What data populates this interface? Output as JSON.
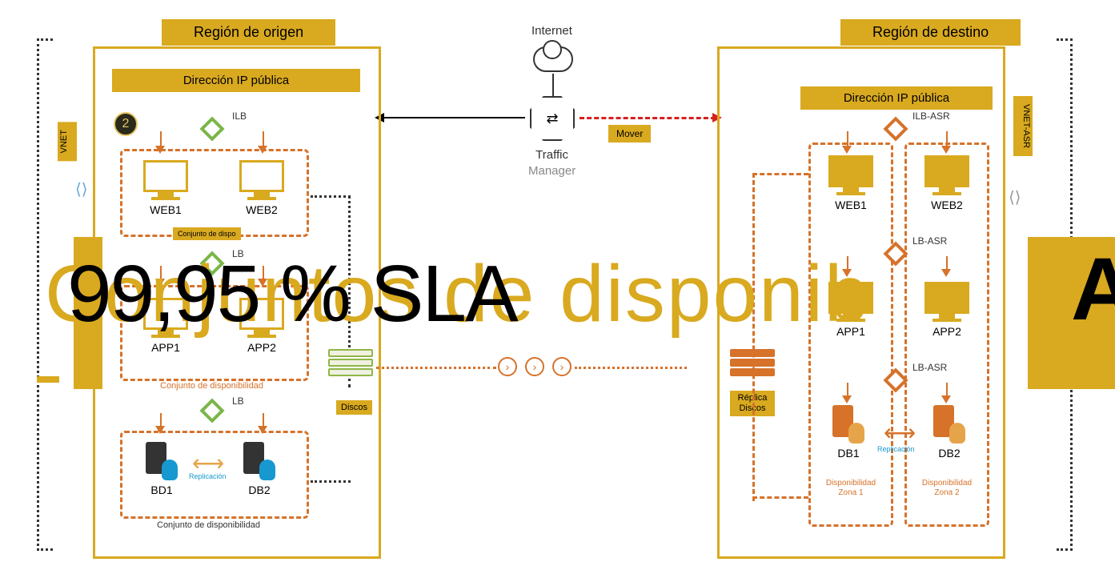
{
  "diagram": {
    "internet_label": "Internet",
    "traffic_manager": "Traffic",
    "traffic_manager_sub": "Manager",
    "mover_label": "Mover"
  },
  "source": {
    "region_title": "Región de origen",
    "public_ip": "Dirección IP pública",
    "ilb": "ILB",
    "lb1": "LB",
    "lb2": "LB",
    "web1": "WEB1",
    "web2": "WEB2",
    "app1": "APP1",
    "app2": "APP2",
    "db1": "BD1",
    "db2": "DB2",
    "avail1": "Conjunto de dispo",
    "avail2": "Conjunto de disponibilidad",
    "avail3": "Conjunto de disponibilidad",
    "replication": "Replicación",
    "discos": "Discos",
    "vnet": "VNET",
    "badge": "2"
  },
  "target": {
    "region_title": "Región de destino",
    "public_ip": "Dirección IP pública",
    "ilb": "ILB-ASR",
    "lb1": "LB-ASR",
    "lb2": "LB-ASR",
    "web1": "WEB1",
    "web2": "WEB2",
    "app1": "APP1",
    "app2": "APP2",
    "db1": "DB1",
    "db2": "DB2",
    "replication": "Replicación",
    "replica_discos": "Réplica Discos",
    "vnet": "VNET-ASR",
    "zone1": "Disponibilidad Zona 1",
    "zone2": "Disponibilidad Zona 2"
  },
  "overlay": {
    "sla": "99,95 % SLA",
    "gold_text": "Conjuntos de disponib",
    "az": "AZ"
  }
}
